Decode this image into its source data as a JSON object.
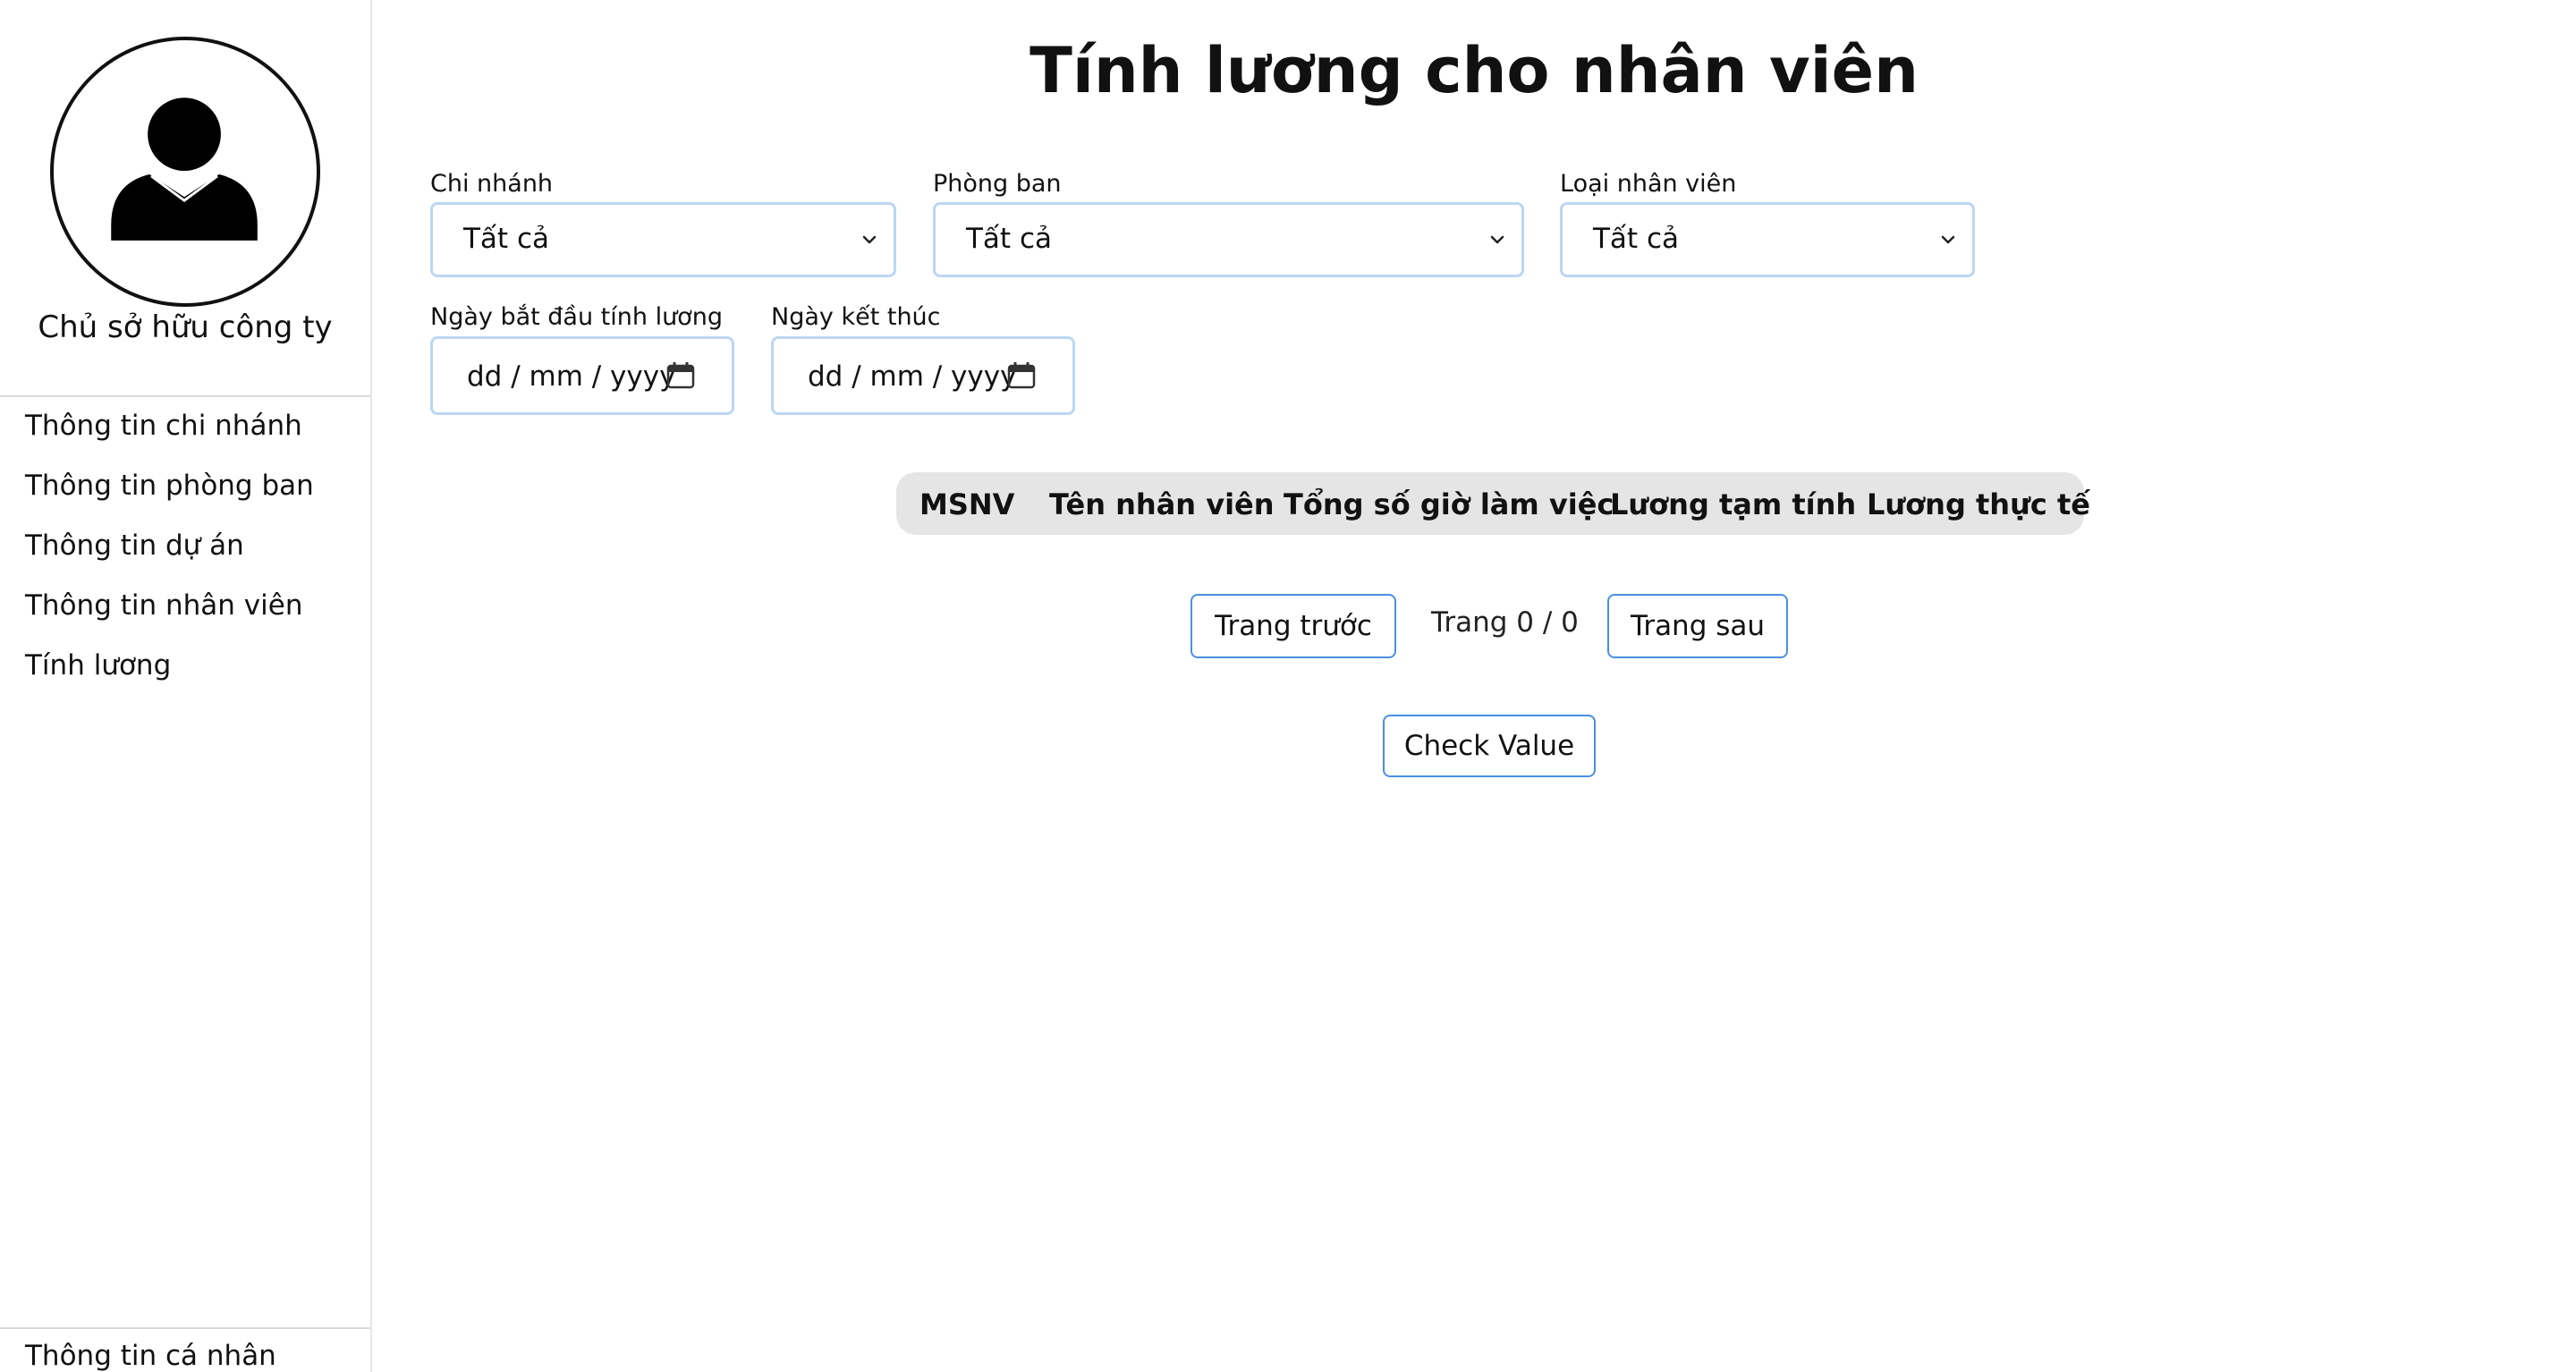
{
  "sidebar": {
    "owner_name": "Chủ sở hữu công ty",
    "avatar_icon": "user-avatar-icon",
    "items": [
      {
        "label": "Thông tin chi nhánh"
      },
      {
        "label": "Thông tin phòng ban"
      },
      {
        "label": "Thông tin dự án"
      },
      {
        "label": "Thông tin nhân viên"
      },
      {
        "label": "Tính lương"
      }
    ],
    "bottom_item": {
      "label": "Thông tin cá nhân"
    }
  },
  "main": {
    "title": "Tính lương cho nhân viên",
    "filters": {
      "branch": {
        "label": "Chi nhánh",
        "value": "Tất cả"
      },
      "department": {
        "label": "Phòng ban",
        "value": "Tất cả"
      },
      "employee_type": {
        "label": "Loại nhân viên",
        "value": "Tất cả"
      }
    },
    "dates": {
      "start": {
        "label": "Ngày bắt đầu tính lương",
        "placeholder": "dd / mm / yyyy"
      },
      "end": {
        "label": "Ngày kết thúc",
        "placeholder": "dd / mm / yyyy"
      }
    },
    "table": {
      "columns": [
        "MSNV",
        "Tên nhân viên",
        "Tổng số giờ làm việc",
        "Lương tạm tính",
        "Lương thực tế"
      ],
      "rows": []
    },
    "pagination": {
      "prev_label": "Trang trước",
      "indicator": "Trang 0 / 0",
      "next_label": "Trang sau"
    },
    "check_button_label": "Check Value"
  },
  "colors": {
    "input_border": "#bcd6f3",
    "button_border": "#4b8fe0",
    "table_header_bg": "#e5e5e5"
  }
}
